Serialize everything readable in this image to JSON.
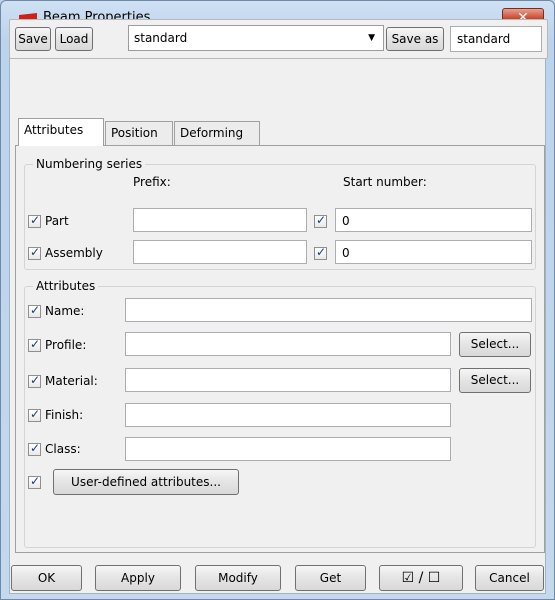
{
  "window": {
    "title": "Beam Properties",
    "close_glyph": "✕"
  },
  "toolbar": {
    "save": "Save",
    "load": "Load",
    "preset_value": "standard",
    "save_as": "Save as",
    "save_as_value": "standard"
  },
  "tabs": [
    "Attributes",
    "Position",
    "Deforming"
  ],
  "numbering": {
    "title": "Numbering series",
    "prefix_header": "Prefix:",
    "start_header": "Start number:",
    "rows": [
      {
        "label": "Part",
        "prefix": "",
        "start": "0"
      },
      {
        "label": "Assembly",
        "prefix": "",
        "start": "0"
      }
    ]
  },
  "attributes": {
    "title": "Attributes",
    "name": {
      "label": "Name:",
      "value": ""
    },
    "profile": {
      "label": "Profile:",
      "value": "",
      "select": "Select..."
    },
    "material": {
      "label": "Material:",
      "value": "",
      "select": "Select..."
    },
    "finish": {
      "label": "Finish:",
      "value": ""
    },
    "class": {
      "label": "Class:",
      "value": ""
    },
    "udas": "User-defined attributes..."
  },
  "footer": {
    "ok": "OK",
    "apply": "Apply",
    "modify": "Modify",
    "get": "Get",
    "toggle": "☑ / ☐",
    "cancel": "Cancel"
  },
  "colors": {
    "title_icon": "#d0201a",
    "close": "#c7452b"
  }
}
